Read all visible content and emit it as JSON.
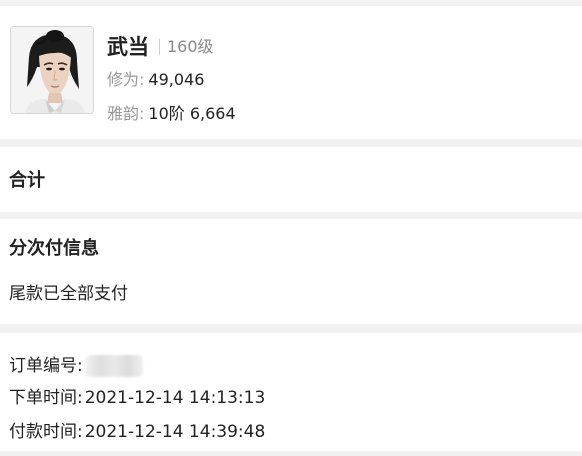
{
  "character": {
    "name": "武当",
    "level": "160级",
    "cultivation_label": "修为:",
    "cultivation_value": "49,046",
    "charm_label": "雅韵:",
    "charm_value": "10阶 6,664"
  },
  "total": {
    "title": "合计"
  },
  "installment": {
    "title": "分次付信息",
    "status": "尾款已全部支付"
  },
  "order": {
    "number_label": "订单编号:",
    "order_time_label": "下单时间:",
    "order_time": "2021-12-14 14:13:13",
    "pay_time_label": "付款时间:",
    "pay_time": "2021-12-14 14:39:48"
  }
}
